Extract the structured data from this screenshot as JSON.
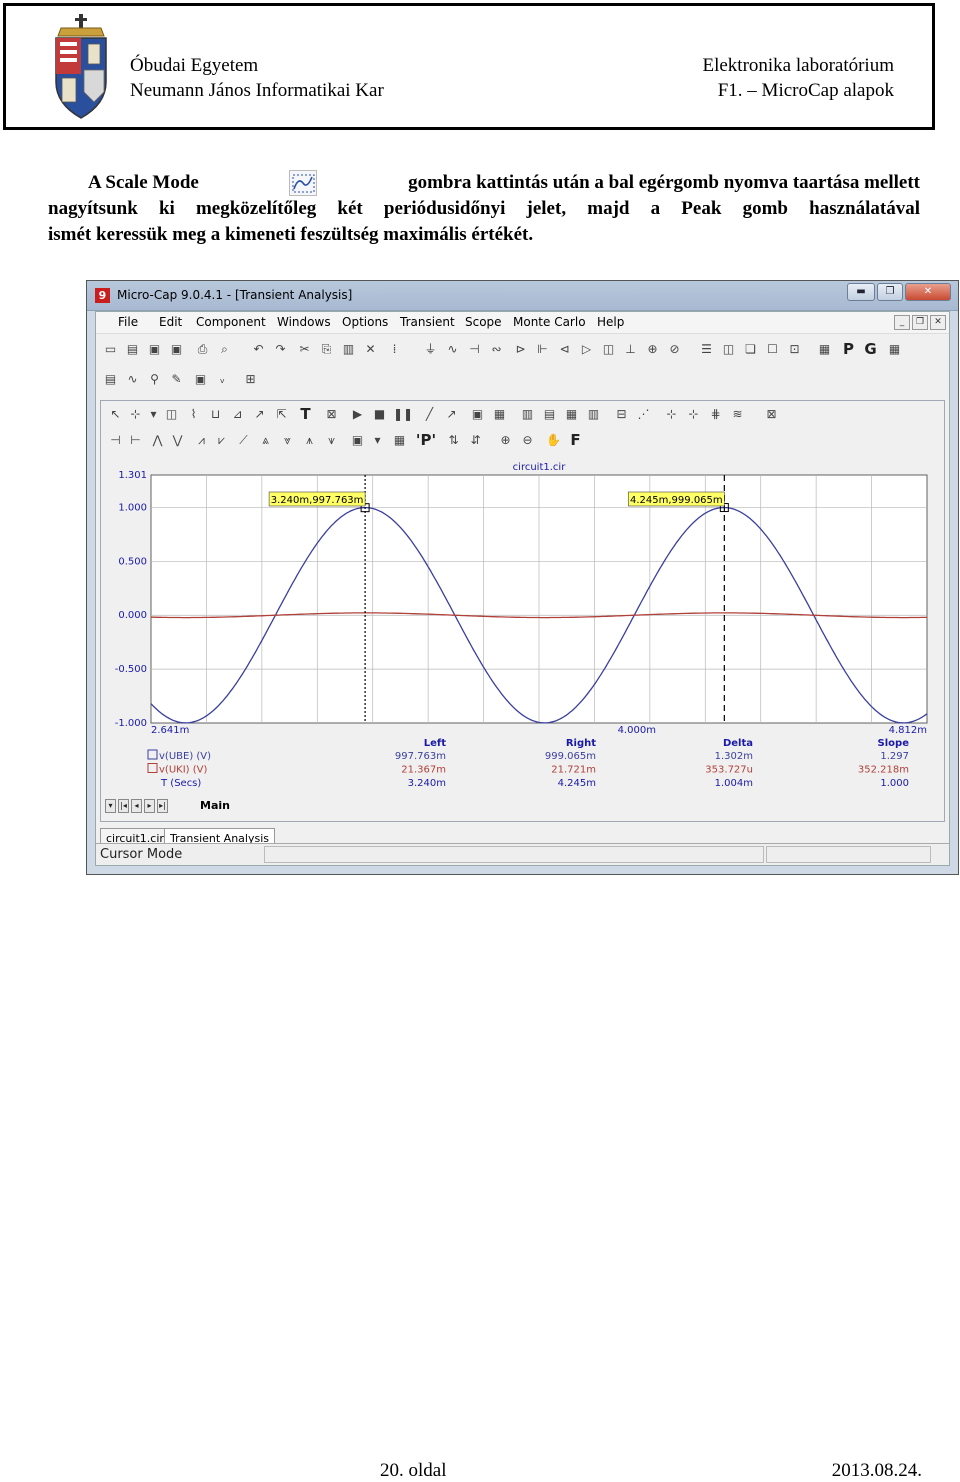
{
  "header": {
    "university": "Óbudai Egyetem",
    "faculty": "Neumann János Informatikai Kar",
    "course": "Elektronika laboratórium",
    "topic": "F1. – MicroCap alapok"
  },
  "paragraph": {
    "line1_start": "A Scale Mode",
    "line1_icon": "scale-mode-icon",
    "line1_end": "gombra kattintás után a bal egérgomb nyomva taartása mellett",
    "line2": "nagyítsunk ki megközelítőleg két periódusidőnyi jelet, majd a Peak gomb használatával",
    "line3": "ismét keressük meg a kimeneti feszültség maximális értékét."
  },
  "window": {
    "title": "Micro-Cap 9.0.4.1 - [Transient Analysis]",
    "app_icon": "9",
    "controls": {
      "minimize": "▬",
      "maximize": "❐",
      "close": "✕"
    },
    "mdi_controls": {
      "minimize": "_",
      "restore": "❐",
      "close": "✕"
    },
    "menu": [
      "File",
      "Edit",
      "Component",
      "Windows",
      "Options",
      "Transient",
      "Scope",
      "Monte Carlo",
      "Help"
    ],
    "toolbar_letters": {
      "p": "P",
      "g": "G",
      "t": "T",
      "f": "F",
      "peak": "'P'"
    },
    "sheet_tab": "Main",
    "doc_tabs": [
      "circuit1.cir",
      "Transient Analysis"
    ],
    "status": "Cursor Mode"
  },
  "colors": {
    "series_ube": "#3a3f9e",
    "series_uki": "#b0403a",
    "cursor_label_bg": "#ffff66",
    "grid": "#b8b8b8",
    "axis_text": "#1a1aa8"
  },
  "chart_data": {
    "type": "line",
    "title": "circuit1.cir",
    "x_start_label": "2.641m",
    "x_mid_label": "4.000m",
    "x_end_label": "4.812m",
    "xlim": [
      0.002641,
      0.004812
    ],
    "ylim": [
      -1.0,
      1.301
    ],
    "y_ticks": [
      {
        "value": 1.301,
        "label": "1.301"
      },
      {
        "value": 1.0,
        "label": "1.000"
      },
      {
        "value": 0.5,
        "label": "0.500"
      },
      {
        "value": 0.0,
        "label": "0.000"
      },
      {
        "value": -0.5,
        "label": "-0.500"
      },
      {
        "value": -1.0,
        "label": "-1.000"
      }
    ],
    "series": [
      {
        "name": "v(UBE) (V)",
        "amplitude": 0.999,
        "period": 0.001004,
        "peak_x": 0.00324
      },
      {
        "name": "v(UKI) (V)",
        "amplitude": 0.0217,
        "period": 0.001004,
        "peak_x": 0.00324
      }
    ],
    "x_axis_name": "T (Secs)",
    "cursors": [
      {
        "x": 0.00324,
        "y": 0.997763,
        "label": "3.240m,997.763m"
      },
      {
        "x": 0.004245,
        "y": 0.999065,
        "label": "4.245m,999.065m"
      }
    ],
    "readout": {
      "headers": [
        "Left",
        "Right",
        "Delta",
        "Slope"
      ],
      "rows": [
        [
          "997.763m",
          "999.065m",
          "1.302m",
          "1.297"
        ],
        [
          "21.367m",
          "21.721m",
          "353.727u",
          "352.218m"
        ],
        [
          "3.240m",
          "4.245m",
          "1.004m",
          "1.000"
        ]
      ]
    },
    "grid": true
  },
  "footer": {
    "page": "20. oldal",
    "date": "2013.08.24."
  }
}
